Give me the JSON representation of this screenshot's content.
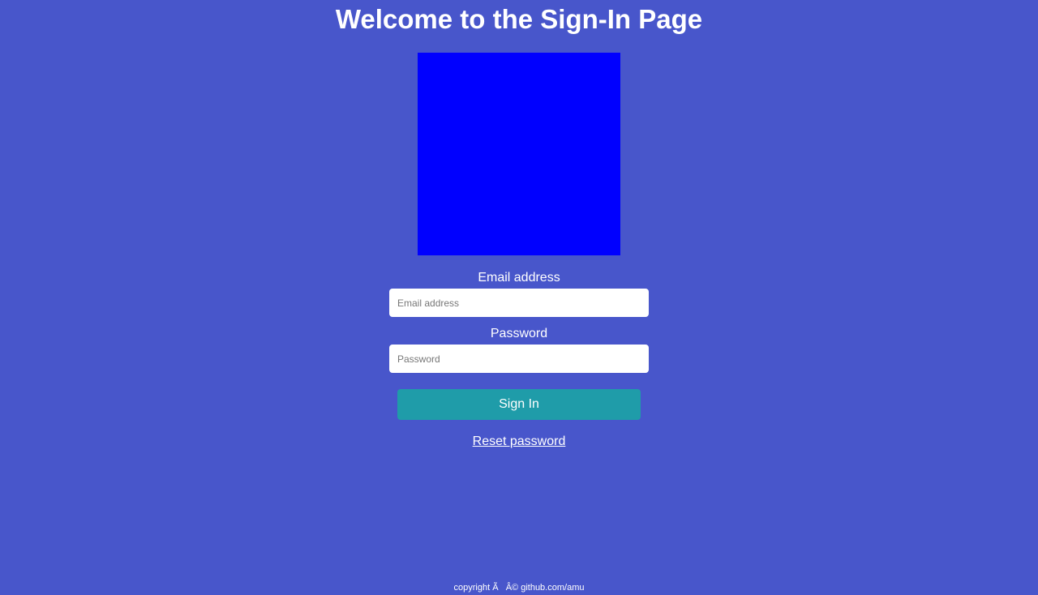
{
  "header": {
    "title": "Welcome to the Sign-In Page"
  },
  "logo": {
    "color": "#0000ff"
  },
  "form": {
    "email_label": "Email address",
    "email_placeholder": "Email address",
    "email_value": "",
    "password_label": "Password",
    "password_placeholder": "Password",
    "password_value": "",
    "signin_label": "Sign In",
    "reset_label": "Reset password"
  },
  "footer": {
    "text": "copyright Ã   Â© github.com/amu"
  },
  "colors": {
    "background": "#4856cb",
    "button": "#1f9ca9",
    "text": "#ffffff"
  }
}
